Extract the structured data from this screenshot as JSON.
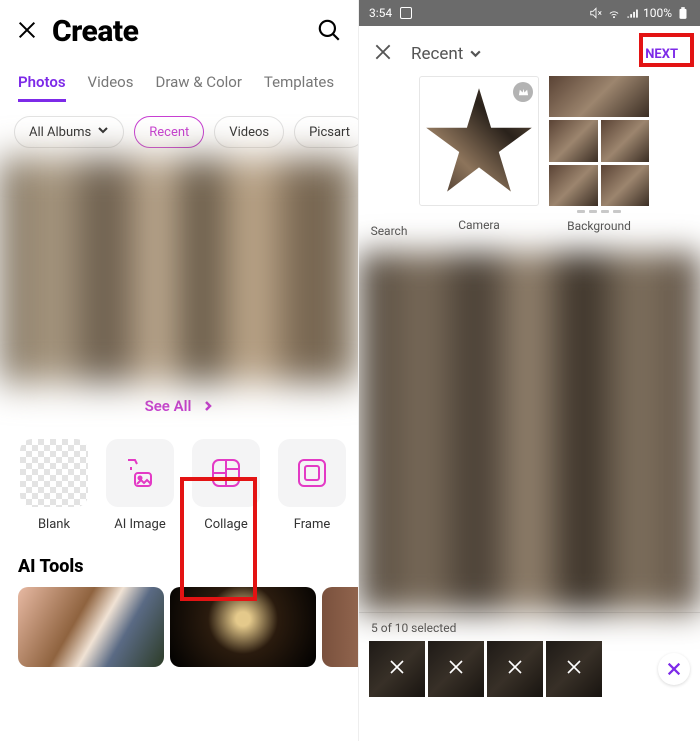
{
  "left": {
    "title": "Create",
    "tabs": [
      "Photos",
      "Videos",
      "Draw & Color",
      "Templates"
    ],
    "chips": [
      "All Albums",
      "Recent",
      "Videos",
      "Picsart"
    ],
    "see_all": "See All",
    "tools": [
      {
        "label": "Blank"
      },
      {
        "label": "AI Image"
      },
      {
        "label": "Collage"
      },
      {
        "label": "Frame"
      }
    ],
    "section": "AI Tools"
  },
  "right": {
    "status": {
      "time": "3:54",
      "battery": "100%"
    },
    "title": "Recent",
    "next": "NEXT",
    "features": [
      "Search",
      "Camera",
      "Background"
    ],
    "selection": "5 of 10 selected"
  }
}
